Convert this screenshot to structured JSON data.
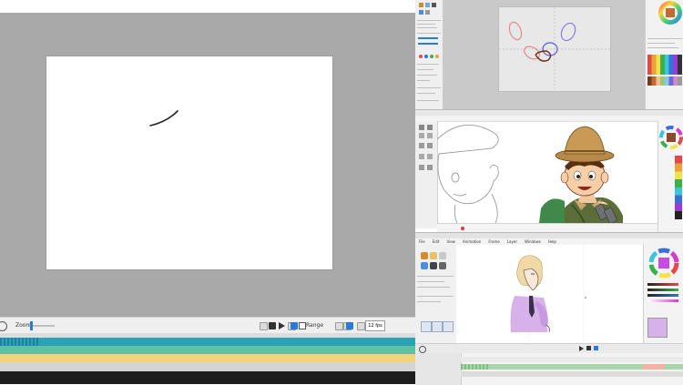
{
  "left_app": {
    "zoom_label": "Zoom:",
    "range_label": "Range",
    "fps_value": "12 fps"
  },
  "right_bottom_app": {
    "menu": [
      "File",
      "Edit",
      "View",
      "Animation",
      "Frame",
      "Layer",
      "Windows",
      "Help"
    ]
  }
}
